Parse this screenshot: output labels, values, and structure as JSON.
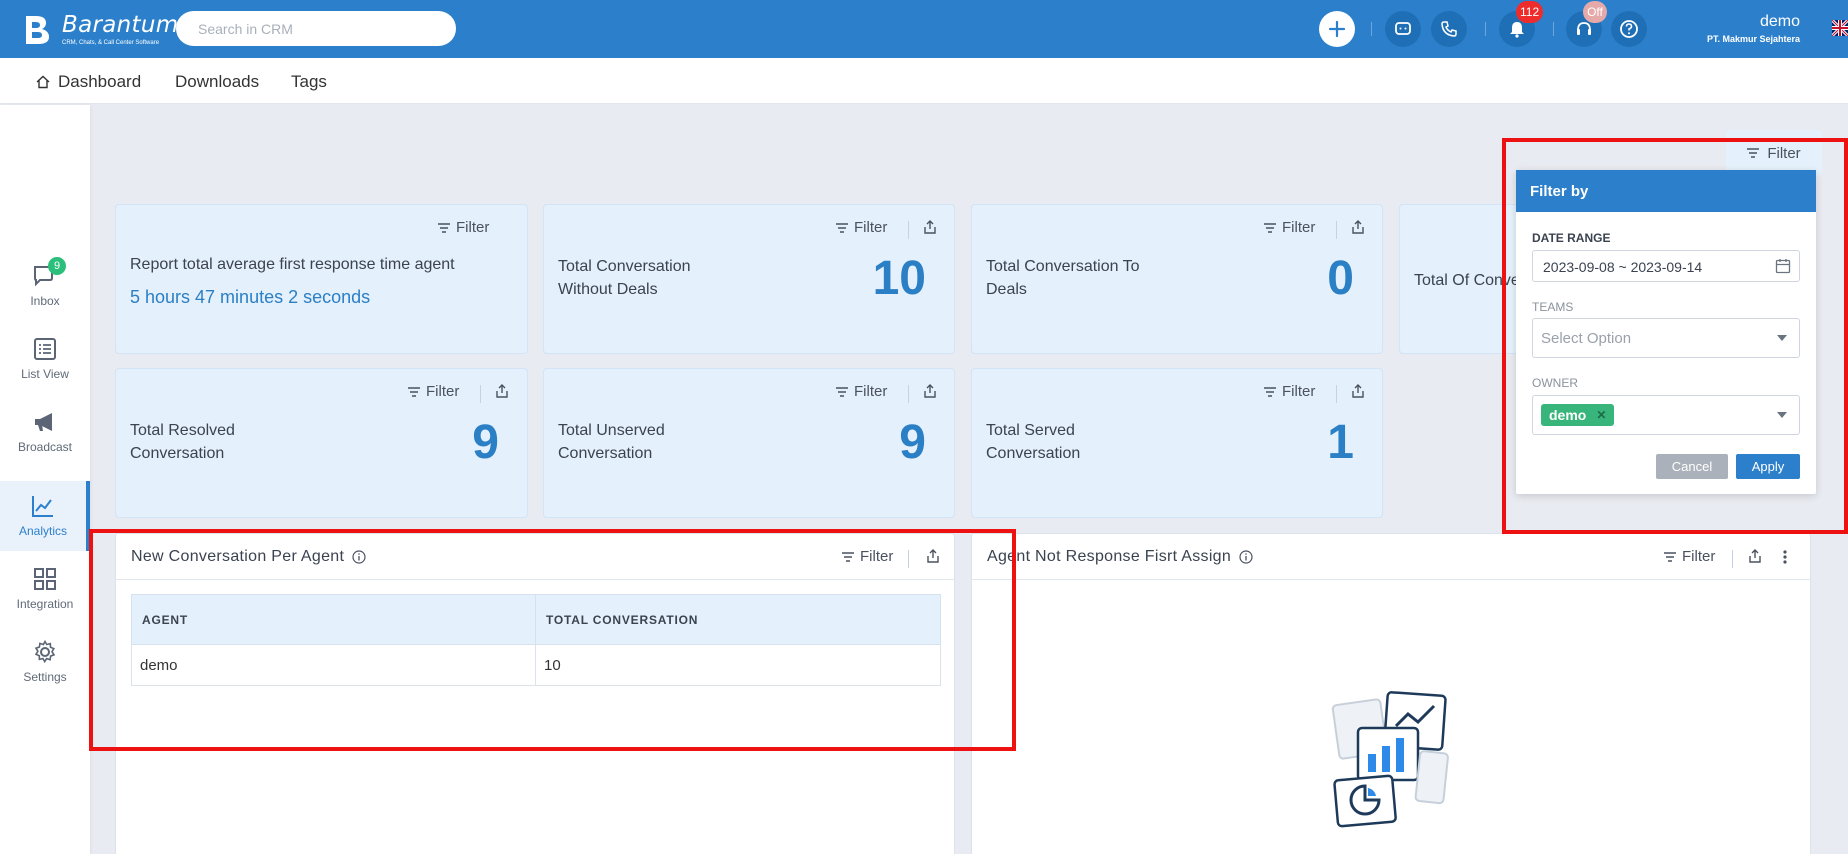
{
  "header": {
    "brand": "Barantum",
    "tagline": "CRM, Chats, & Call Center Software",
    "search_placeholder": "Search in CRM",
    "notification_count": "112",
    "phone_status": "Off",
    "user_name": "demo",
    "user_company": "PT. Makmur Sejahtera",
    "accent_color": "#2c80cb"
  },
  "subnav": {
    "items": [
      "Dashboard",
      "Downloads",
      "Tags"
    ]
  },
  "sidebar": {
    "inbox_badge": "9",
    "items": [
      {
        "label": "Inbox",
        "icon": "chat-icon"
      },
      {
        "label": "List View",
        "icon": "list-icon"
      },
      {
        "label": "Broadcast",
        "icon": "megaphone-icon"
      },
      {
        "label": "Analytics",
        "icon": "chart-line-icon"
      },
      {
        "label": "Integration",
        "icon": "grid-icon"
      },
      {
        "label": "Settings",
        "icon": "gear-icon"
      }
    ]
  },
  "page_filter_label": "Filter",
  "cards": {
    "filter_label": "Filter",
    "avg_response": {
      "title": "Report total average first response time agent",
      "value": "5 hours 47 minutes 2 seconds"
    },
    "without_deals": {
      "title_1": "Total Conversation",
      "title_2": "Without Deals",
      "value": "10"
    },
    "to_deals": {
      "title_1": "Total Conversation To",
      "title_2": "Deals",
      "value": "0"
    },
    "total_of": {
      "title": "Total Of Conve"
    },
    "resolved": {
      "title_1": "Total Resolved",
      "title_2": "Conversation",
      "value": "9"
    },
    "unserved": {
      "title_1": "Total Unserved",
      "title_2": "Conversation",
      "value": "9"
    },
    "served": {
      "title_1": "Total Served",
      "title_2": "Conversation",
      "value": "1"
    }
  },
  "panel_agent": {
    "title": "New Conversation Per Agent",
    "filter_label": "Filter",
    "columns": [
      "AGENT",
      "TOTAL CONVERSATION"
    ],
    "rows": [
      [
        "demo",
        "10"
      ]
    ]
  },
  "panel_not_response": {
    "title": "Agent Not Response Fisrt Assign",
    "filter_label": "Filter"
  },
  "filter_popup": {
    "title": "Filter by",
    "date_range_label": "DATE RANGE",
    "date_range_value": "2023-09-08 ~ 2023-09-14",
    "teams_label": "TEAMS",
    "teams_placeholder": "Select Option",
    "owner_label": "OWNER",
    "owner_chip": "demo",
    "cancel_label": "Cancel",
    "apply_label": "Apply"
  }
}
